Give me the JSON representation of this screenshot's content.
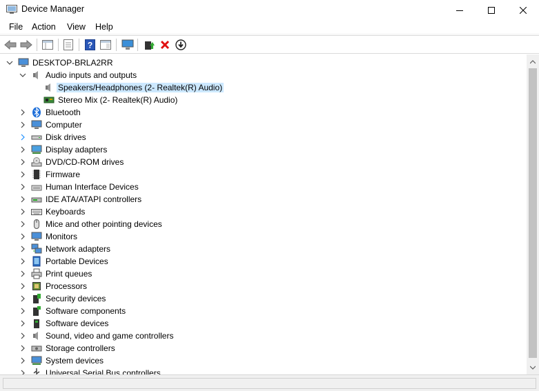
{
  "window": {
    "title": "Device Manager"
  },
  "menu": [
    "File",
    "Action",
    "View",
    "Help"
  ],
  "tree": {
    "root": "DESKTOP-BRLA2RR",
    "category_expanded": "Audio inputs and outputs",
    "children": [
      {
        "label": "Speakers/Headphones (2- Realtek(R) Audio)",
        "selected": true
      },
      {
        "label": "Stereo Mix (2- Realtek(R) Audio)",
        "selected": false
      }
    ],
    "categories": [
      "Bluetooth",
      "Computer",
      "Disk drives",
      "Display adapters",
      "DVD/CD-ROM drives",
      "Firmware",
      "Human Interface Devices",
      "IDE ATA/ATAPI controllers",
      "Keyboards",
      "Mice and other pointing devices",
      "Monitors",
      "Network adapters",
      "Portable Devices",
      "Print queues",
      "Processors",
      "Security devices",
      "Software components",
      "Software devices",
      "Sound, video and game controllers",
      "Storage controllers",
      "System devices",
      "Universal Serial Bus controllers"
    ]
  },
  "colors": {
    "selection": "#cce8ff",
    "accent": "#1e90ff"
  }
}
